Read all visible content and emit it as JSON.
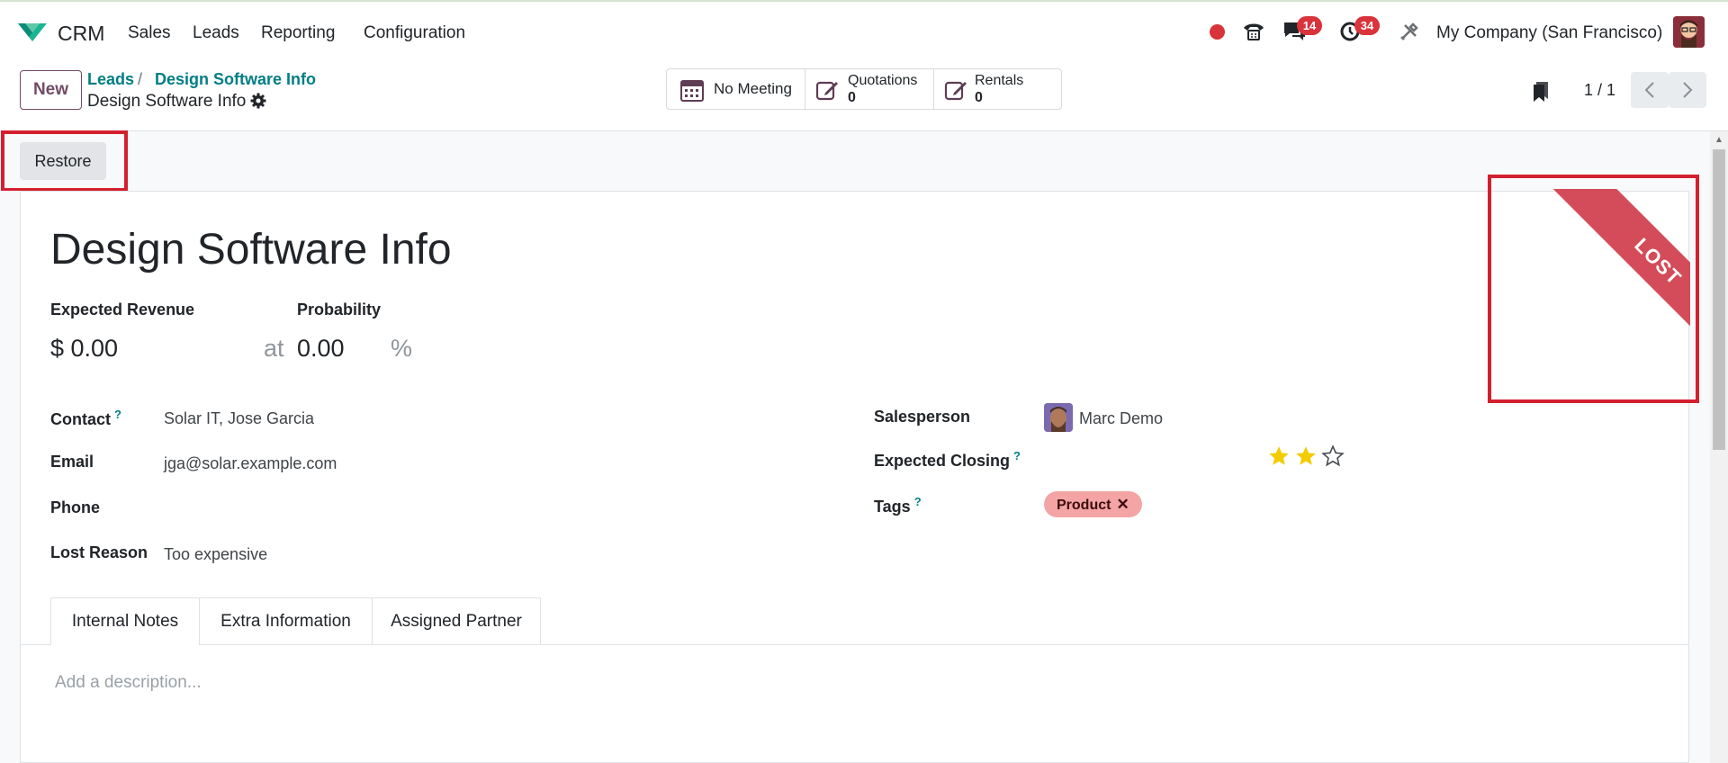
{
  "topbar": {
    "app_name": "CRM",
    "menu": [
      "Sales",
      "Leads",
      "Reporting",
      "Configuration"
    ],
    "messages_badge": "14",
    "activities_badge": "34",
    "company": "My Company (San Francisco)"
  },
  "control": {
    "new_label": "New",
    "breadcrumb_root": "Leads",
    "breadcrumb_sep": "/",
    "breadcrumb_current": "Design Software Info",
    "record_name": "Design Software Info",
    "smart_buttons": {
      "meeting": "No Meeting",
      "quotations_label": "Quotations",
      "quotations_count": "0",
      "rentals_label": "Rentals",
      "rentals_count": "0"
    },
    "pager": "1 / 1"
  },
  "statusbar": {
    "restore_label": "Restore"
  },
  "form": {
    "title": "Design Software Info",
    "expected_revenue_label": "Expected Revenue",
    "expected_revenue_value": "$ 0.00",
    "at_label": "at",
    "probability_label": "Probability",
    "probability_value": "0.00",
    "percent": "%",
    "contact_label": "Contact",
    "contact_value": "Solar IT, Jose Garcia",
    "email_label": "Email",
    "email_value": "jga@solar.example.com",
    "phone_label": "Phone",
    "lost_reason_label": "Lost Reason",
    "lost_reason_value": "Too expensive",
    "salesperson_label": "Salesperson",
    "salesperson_value": "Marc Demo",
    "expected_closing_label": "Expected Closing",
    "priority_stars": 2,
    "priority_max": 3,
    "tags_label": "Tags",
    "tag": "Product",
    "help_mark": "?",
    "ribbon": "LOST"
  },
  "tabs": [
    "Internal Notes",
    "Extra Information",
    "Assigned Partner"
  ],
  "notes_placeholder": "Add a description...",
  "colors": {
    "brand": "#714b67",
    "link": "#017e84",
    "ribbon": "#d44c59",
    "highlight": "#d3202f",
    "star": "#f3cc00"
  }
}
